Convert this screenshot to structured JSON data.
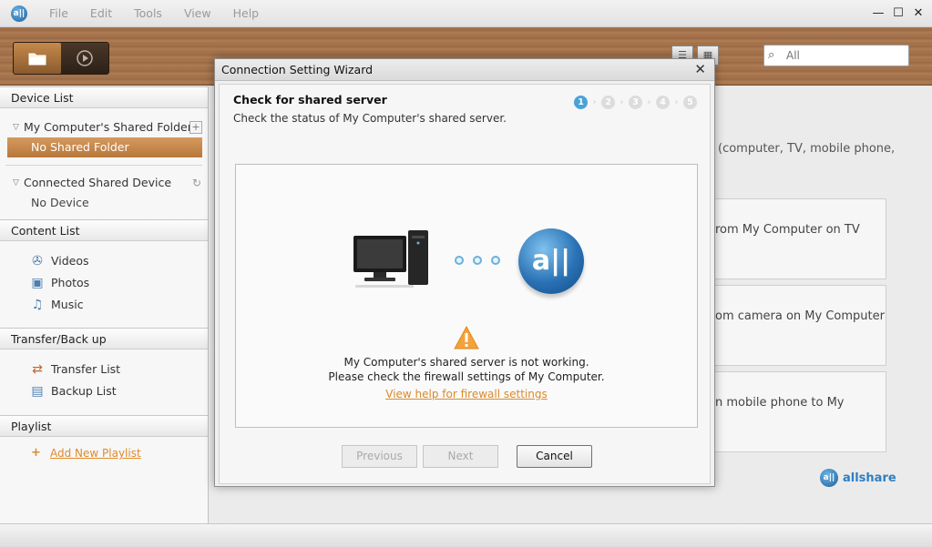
{
  "app": {
    "menu": [
      "File",
      "Edit",
      "Tools",
      "View",
      "Help"
    ],
    "window_controls": {
      "minimize": "—",
      "maximize": "☐",
      "close": "✕"
    },
    "logo_text": "a||"
  },
  "toolbar": {
    "search_placeholder": "All",
    "icons": [
      "folder-icon",
      "play-icon",
      "list-view-icon",
      "grid-view-icon",
      "search-icon"
    ]
  },
  "sidebar": {
    "device_list": {
      "title": "Device List",
      "my_computer": {
        "label": "My Computer's Shared Folder",
        "selected_item": "No Shared Folder"
      },
      "connected": {
        "label": "Connected Shared Device",
        "item": "No Device"
      }
    },
    "content_list": {
      "title": "Content List",
      "items": [
        {
          "label": "Videos",
          "icon": "film-reel-icon"
        },
        {
          "label": "Photos",
          "icon": "photo-icon"
        },
        {
          "label": "Music",
          "icon": "music-note-icon"
        }
      ]
    },
    "transfer": {
      "title": "Transfer/Back up",
      "items": [
        {
          "label": "Transfer List",
          "icon": "transfer-icon"
        },
        {
          "label": "Backup List",
          "icon": "backup-icon"
        }
      ]
    },
    "playlist": {
      "title": "Playlist",
      "add_label": "Add New Playlist"
    }
  },
  "main": {
    "partial_text": "(computer, TV, mobile phone,",
    "cards": [
      "rom My Computer on TV",
      "om camera on My Computer",
      "n mobile phone to My"
    ],
    "brand": "allshare"
  },
  "dialog": {
    "title": "Connection Setting Wizard",
    "close": "✕",
    "step_title": "Check for shared server",
    "step_desc": "Check the status of My Computer's shared server.",
    "steps": [
      "1",
      "2",
      "3",
      "4",
      "5"
    ],
    "active_step": 1,
    "allshare_icon_text": "a||",
    "message_line1": "My Computer's shared server is not working.",
    "message_line2": "Please check the firewall settings of My Computer.",
    "help_link": "View help for firewall settings",
    "buttons": {
      "previous": "Previous",
      "next": "Next",
      "cancel": "Cancel"
    }
  }
}
